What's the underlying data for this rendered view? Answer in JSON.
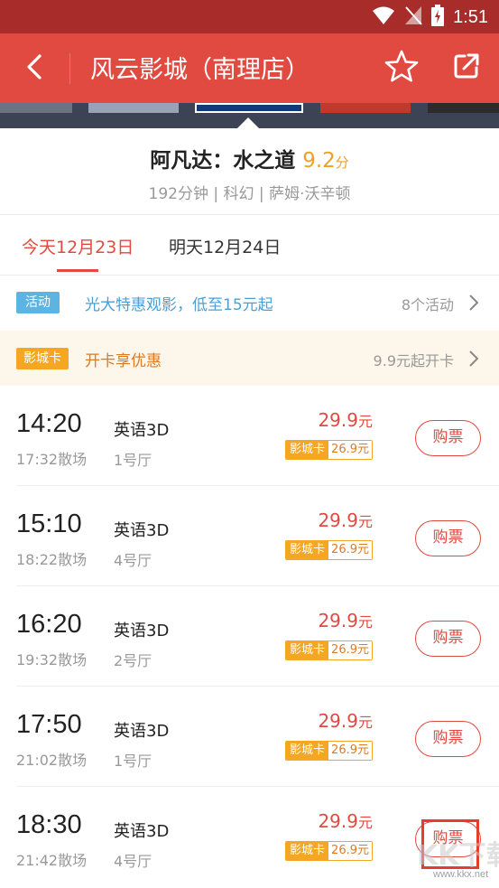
{
  "status_bar": {
    "time": "1:51"
  },
  "app_bar": {
    "title": "风云影城（南理店）"
  },
  "movie": {
    "title": "阿凡达：水之道",
    "score": "9.2",
    "score_unit": "分",
    "meta": "192分钟 | 科幻 | 萨姆·沃辛顿"
  },
  "tabs": [
    {
      "label": "今天12月23日",
      "active": true
    },
    {
      "label": "明天12月24日",
      "active": false
    }
  ],
  "activity": {
    "badge": "活动",
    "text": "光大特惠观影，低至15元起",
    "count": "8个活动"
  },
  "member_card": {
    "badge": "影城卡",
    "text": "开卡享优惠",
    "price": "9.9元起开卡"
  },
  "showtimes": [
    {
      "start": "14:20",
      "end": "17:32散场",
      "lang": "英语3D",
      "hall": "1号厅",
      "price": "29.9",
      "price_unit": "元",
      "card_label": "影城卡",
      "card_price": "26.9元",
      "buy_label": "购票"
    },
    {
      "start": "15:10",
      "end": "18:22散场",
      "lang": "英语3D",
      "hall": "4号厅",
      "price": "29.9",
      "price_unit": "元",
      "card_label": "影城卡",
      "card_price": "26.9元",
      "buy_label": "购票"
    },
    {
      "start": "16:20",
      "end": "19:32散场",
      "lang": "英语3D",
      "hall": "2号厅",
      "price": "29.9",
      "price_unit": "元",
      "card_label": "影城卡",
      "card_price": "26.9元",
      "buy_label": "购票"
    },
    {
      "start": "17:50",
      "end": "21:02散场",
      "lang": "英语3D",
      "hall": "1号厅",
      "price": "29.9",
      "price_unit": "元",
      "card_label": "影城卡",
      "card_price": "26.9元",
      "buy_label": "购票"
    },
    {
      "start": "18:30",
      "end": "21:42散场",
      "lang": "英语3D",
      "hall": "4号厅",
      "price": "29.9",
      "price_unit": "元",
      "card_label": "影城卡",
      "card_price": "26.9元",
      "buy_label": "购票"
    }
  ],
  "watermark": {
    "text": "KK下载",
    "url": "www.kkx.net"
  },
  "icons": {
    "back": "back-arrow-icon",
    "star": "star-icon",
    "share": "share-icon",
    "wifi": "wifi-icon",
    "signal": "signal-icon",
    "battery": "battery-icon",
    "chevron": "chevron-right-icon"
  },
  "colors": {
    "status_bar": "#a82c29",
    "app_bar": "#e04a41",
    "accent": "#e04a41",
    "score": "#f0a022",
    "activity_blue": "#4a9fd8",
    "card_orange": "#f5a623",
    "card_bg": "#fdf6ea"
  }
}
